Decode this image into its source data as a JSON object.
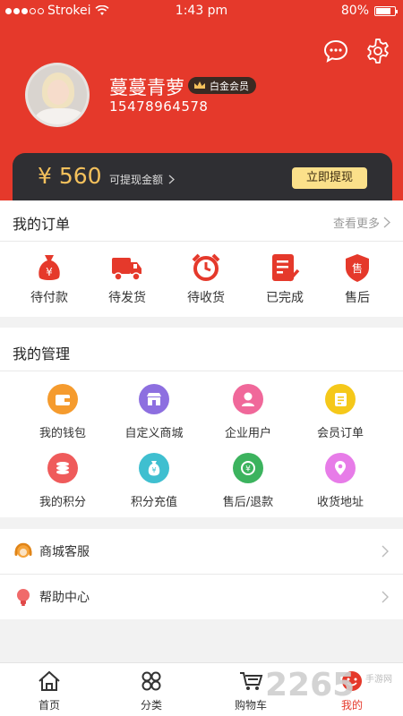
{
  "status_bar": {
    "carrier": "Strokei",
    "time": "1:43 pm",
    "battery": "80%",
    "battery_level": 0.8
  },
  "profile": {
    "name": "蔓蔓青萝",
    "badge": "白金会员",
    "phone": "15478964578"
  },
  "wallet": {
    "amount": "¥ 560",
    "label": "可提现金额",
    "action": "立即提现"
  },
  "orders": {
    "title": "我的订单",
    "more": "查看更多",
    "items": [
      {
        "label": "待付款",
        "icon": "money-bag-icon"
      },
      {
        "label": "待发货",
        "icon": "truck-icon"
      },
      {
        "label": "待收货",
        "icon": "alarm-clock-icon"
      },
      {
        "label": "已完成",
        "icon": "completed-list-icon"
      },
      {
        "label": "售后",
        "icon": "after-sale-shield-icon"
      }
    ]
  },
  "management": {
    "title": "我的管理",
    "items": [
      {
        "label": "我的钱包",
        "icon": "wallet-icon",
        "color": "#f59b2e"
      },
      {
        "label": "自定义商城",
        "icon": "store-icon",
        "color": "#8d6fe0"
      },
      {
        "label": "企业用户",
        "icon": "user-icon",
        "color": "#f0689a"
      },
      {
        "label": "会员订单",
        "icon": "clipboard-icon",
        "color": "#f5c81a"
      },
      {
        "label": "我的积分",
        "icon": "coins-icon",
        "color": "#ef5b5b"
      },
      {
        "label": "积分充值",
        "icon": "yuan-bag-icon",
        "color": "#3fbfd0"
      },
      {
        "label": "售后/退款",
        "icon": "refund-icon",
        "color": "#3cb35e"
      },
      {
        "label": "收货地址",
        "icon": "location-pin-icon",
        "color": "#e77ce8"
      }
    ]
  },
  "links": [
    {
      "label": "商城客服",
      "icon": "customer-service-icon"
    },
    {
      "label": "帮助中心",
      "icon": "help-bulb-icon"
    }
  ],
  "tabbar": [
    {
      "label": "首页",
      "icon": "home-icon"
    },
    {
      "label": "分类",
      "icon": "category-icon"
    },
    {
      "label": "购物车",
      "icon": "cart-icon"
    },
    {
      "label": "我的",
      "icon": "profile-face-icon"
    }
  ],
  "watermark": {
    "logo": "2265",
    "text": "手游网"
  },
  "colors": {
    "brand": "#e5392b",
    "wallet_bg": "#2f2f33",
    "gold": "#f4c15c"
  }
}
